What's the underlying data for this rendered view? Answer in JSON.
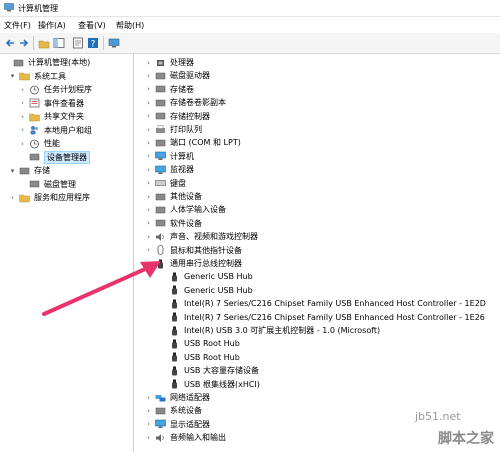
{
  "window": {
    "title": "计算机管理"
  },
  "menu": [
    "文件(F)",
    "操作(A)",
    "查看(V)",
    "帮助(H)"
  ],
  "left_tree": [
    {
      "label": "计算机管理(本地)",
      "icon": "computer-management-icon",
      "expander": ""
    },
    {
      "label": "系统工具",
      "icon": "tools-icon",
      "expander": "▾"
    },
    {
      "label": "任务计划程序",
      "icon": "clock-icon",
      "expander": "›"
    },
    {
      "label": "事件查看器",
      "icon": "event-icon",
      "expander": "›"
    },
    {
      "label": "共享文件夹",
      "icon": "folder-icon",
      "expander": "›"
    },
    {
      "label": "本地用户和组",
      "icon": "users-icon",
      "expander": "›"
    },
    {
      "label": "性能",
      "icon": "performance-icon",
      "expander": "›"
    },
    {
      "label": "设备管理器",
      "icon": "device-manager-icon",
      "expander": "",
      "selected": true
    },
    {
      "label": "存储",
      "icon": "storage-icon",
      "expander": "▾"
    },
    {
      "label": "磁盘管理",
      "icon": "disk-icon",
      "expander": ""
    },
    {
      "label": "服务和应用程序",
      "icon": "services-icon",
      "expander": "›"
    }
  ],
  "device_tree": [
    {
      "label": "处理器",
      "icon": "processor-icon",
      "expander": "›"
    },
    {
      "label": "磁盘驱动器",
      "icon": "disk-drive-icon",
      "expander": "›"
    },
    {
      "label": "存储卷",
      "icon": "storage-volume-icon",
      "expander": "›"
    },
    {
      "label": "存储卷卷影副本",
      "icon": "shadow-copy-icon",
      "expander": "›"
    },
    {
      "label": "存储控制器",
      "icon": "storage-controller-icon",
      "expander": "›"
    },
    {
      "label": "打印队列",
      "icon": "printer-icon",
      "expander": "›"
    },
    {
      "label": "端口 (COM 和 LPT)",
      "icon": "port-icon",
      "expander": "›"
    },
    {
      "label": "计算机",
      "icon": "computer-icon",
      "expander": "›"
    },
    {
      "label": "监视器",
      "icon": "monitor-icon",
      "expander": "›"
    },
    {
      "label": "键盘",
      "icon": "keyboard-icon",
      "expander": "›"
    },
    {
      "label": "其他设备",
      "icon": "other-device-icon",
      "expander": "›"
    },
    {
      "label": "人体学输入设备",
      "icon": "hid-icon",
      "expander": "›"
    },
    {
      "label": "软件设备",
      "icon": "software-device-icon",
      "expander": "›"
    },
    {
      "label": "声音、视频和游戏控制器",
      "icon": "sound-icon",
      "expander": "›"
    },
    {
      "label": "鼠标和其他指针设备",
      "icon": "mouse-icon",
      "expander": "›"
    },
    {
      "label": "通用串行总线控制器",
      "icon": "usb-icon",
      "expander": "▾"
    },
    {
      "label": "Generic USB Hub",
      "icon": "usb-icon",
      "expander": "",
      "child": true
    },
    {
      "label": "Generic USB Hub",
      "icon": "usb-icon",
      "expander": "",
      "child": true
    },
    {
      "label": "Intel(R) 7 Series/C216 Chipset Family USB Enhanced Host Controller - 1E2D",
      "icon": "usb-icon",
      "expander": "",
      "child": true
    },
    {
      "label": "Intel(R) 7 Series/C216 Chipset Family USB Enhanced Host Controller - 1E26",
      "icon": "usb-icon",
      "expander": "",
      "child": true
    },
    {
      "label": "Intel(R) USB 3.0 可扩展主机控制器 - 1.0 (Microsoft)",
      "icon": "usb-icon",
      "expander": "",
      "child": true
    },
    {
      "label": "USB Root Hub",
      "icon": "usb-icon",
      "expander": "",
      "child": true
    },
    {
      "label": "USB Root Hub",
      "icon": "usb-icon",
      "expander": "",
      "child": true
    },
    {
      "label": "USB 大容量存储设备",
      "icon": "usb-icon",
      "expander": "",
      "child": true
    },
    {
      "label": "USB 根集线器(xHCI)",
      "icon": "usb-icon",
      "expander": "",
      "child": true
    },
    {
      "label": "网络适配器",
      "icon": "network-icon",
      "expander": "›"
    },
    {
      "label": "系统设备",
      "icon": "system-device-icon",
      "expander": "›"
    },
    {
      "label": "显示适配器",
      "icon": "display-adapter-icon",
      "expander": "›"
    },
    {
      "label": "音频输入和输出",
      "icon": "audio-icon",
      "expander": "›"
    }
  ],
  "watermark": {
    "site": "jb51.net",
    "brand": "脚本之家"
  },
  "colors": {
    "selection": "#cce8ff",
    "arrow": "#e8336b"
  }
}
